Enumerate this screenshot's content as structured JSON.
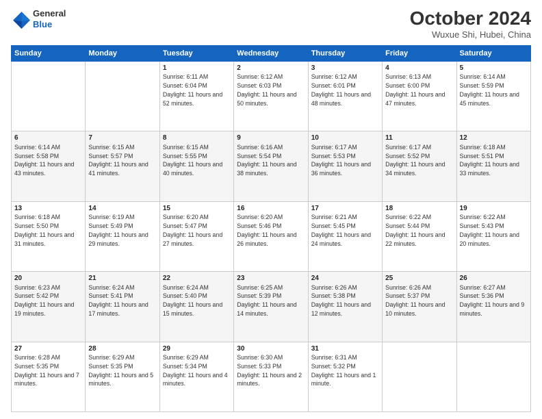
{
  "header": {
    "logo_line1": "General",
    "logo_line2": "Blue",
    "month_title": "October 2024",
    "location": "Wuxue Shi, Hubei, China"
  },
  "days_of_week": [
    "Sunday",
    "Monday",
    "Tuesday",
    "Wednesday",
    "Thursday",
    "Friday",
    "Saturday"
  ],
  "weeks": [
    [
      {
        "day": "",
        "info": ""
      },
      {
        "day": "",
        "info": ""
      },
      {
        "day": "1",
        "info": "Sunrise: 6:11 AM\nSunset: 6:04 PM\nDaylight: 11 hours and 52 minutes."
      },
      {
        "day": "2",
        "info": "Sunrise: 6:12 AM\nSunset: 6:03 PM\nDaylight: 11 hours and 50 minutes."
      },
      {
        "day": "3",
        "info": "Sunrise: 6:12 AM\nSunset: 6:01 PM\nDaylight: 11 hours and 48 minutes."
      },
      {
        "day": "4",
        "info": "Sunrise: 6:13 AM\nSunset: 6:00 PM\nDaylight: 11 hours and 47 minutes."
      },
      {
        "day": "5",
        "info": "Sunrise: 6:14 AM\nSunset: 5:59 PM\nDaylight: 11 hours and 45 minutes."
      }
    ],
    [
      {
        "day": "6",
        "info": "Sunrise: 6:14 AM\nSunset: 5:58 PM\nDaylight: 11 hours and 43 minutes."
      },
      {
        "day": "7",
        "info": "Sunrise: 6:15 AM\nSunset: 5:57 PM\nDaylight: 11 hours and 41 minutes."
      },
      {
        "day": "8",
        "info": "Sunrise: 6:15 AM\nSunset: 5:55 PM\nDaylight: 11 hours and 40 minutes."
      },
      {
        "day": "9",
        "info": "Sunrise: 6:16 AM\nSunset: 5:54 PM\nDaylight: 11 hours and 38 minutes."
      },
      {
        "day": "10",
        "info": "Sunrise: 6:17 AM\nSunset: 5:53 PM\nDaylight: 11 hours and 36 minutes."
      },
      {
        "day": "11",
        "info": "Sunrise: 6:17 AM\nSunset: 5:52 PM\nDaylight: 11 hours and 34 minutes."
      },
      {
        "day": "12",
        "info": "Sunrise: 6:18 AM\nSunset: 5:51 PM\nDaylight: 11 hours and 33 minutes."
      }
    ],
    [
      {
        "day": "13",
        "info": "Sunrise: 6:18 AM\nSunset: 5:50 PM\nDaylight: 11 hours and 31 minutes."
      },
      {
        "day": "14",
        "info": "Sunrise: 6:19 AM\nSunset: 5:49 PM\nDaylight: 11 hours and 29 minutes."
      },
      {
        "day": "15",
        "info": "Sunrise: 6:20 AM\nSunset: 5:47 PM\nDaylight: 11 hours and 27 minutes."
      },
      {
        "day": "16",
        "info": "Sunrise: 6:20 AM\nSunset: 5:46 PM\nDaylight: 11 hours and 26 minutes."
      },
      {
        "day": "17",
        "info": "Sunrise: 6:21 AM\nSunset: 5:45 PM\nDaylight: 11 hours and 24 minutes."
      },
      {
        "day": "18",
        "info": "Sunrise: 6:22 AM\nSunset: 5:44 PM\nDaylight: 11 hours and 22 minutes."
      },
      {
        "day": "19",
        "info": "Sunrise: 6:22 AM\nSunset: 5:43 PM\nDaylight: 11 hours and 20 minutes."
      }
    ],
    [
      {
        "day": "20",
        "info": "Sunrise: 6:23 AM\nSunset: 5:42 PM\nDaylight: 11 hours and 19 minutes."
      },
      {
        "day": "21",
        "info": "Sunrise: 6:24 AM\nSunset: 5:41 PM\nDaylight: 11 hours and 17 minutes."
      },
      {
        "day": "22",
        "info": "Sunrise: 6:24 AM\nSunset: 5:40 PM\nDaylight: 11 hours and 15 minutes."
      },
      {
        "day": "23",
        "info": "Sunrise: 6:25 AM\nSunset: 5:39 PM\nDaylight: 11 hours and 14 minutes."
      },
      {
        "day": "24",
        "info": "Sunrise: 6:26 AM\nSunset: 5:38 PM\nDaylight: 11 hours and 12 minutes."
      },
      {
        "day": "25",
        "info": "Sunrise: 6:26 AM\nSunset: 5:37 PM\nDaylight: 11 hours and 10 minutes."
      },
      {
        "day": "26",
        "info": "Sunrise: 6:27 AM\nSunset: 5:36 PM\nDaylight: 11 hours and 9 minutes."
      }
    ],
    [
      {
        "day": "27",
        "info": "Sunrise: 6:28 AM\nSunset: 5:35 PM\nDaylight: 11 hours and 7 minutes."
      },
      {
        "day": "28",
        "info": "Sunrise: 6:29 AM\nSunset: 5:35 PM\nDaylight: 11 hours and 5 minutes."
      },
      {
        "day": "29",
        "info": "Sunrise: 6:29 AM\nSunset: 5:34 PM\nDaylight: 11 hours and 4 minutes."
      },
      {
        "day": "30",
        "info": "Sunrise: 6:30 AM\nSunset: 5:33 PM\nDaylight: 11 hours and 2 minutes."
      },
      {
        "day": "31",
        "info": "Sunrise: 6:31 AM\nSunset: 5:32 PM\nDaylight: 11 hours and 1 minute."
      },
      {
        "day": "",
        "info": ""
      },
      {
        "day": "",
        "info": ""
      }
    ]
  ]
}
